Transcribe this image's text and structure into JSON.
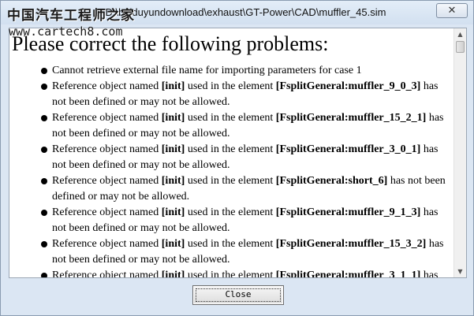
{
  "window": {
    "title_path": "e: D:\\baiduyundownload\\exhaust\\GT-Power\\CAD\\muffler_45.sim",
    "close_glyph": "✕"
  },
  "watermark": {
    "title": "中国汽车工程师之家",
    "url": "www.cartech8.com"
  },
  "content": {
    "heading": "Please correct the following problems:",
    "problems": [
      {
        "plain": "Cannot retrieve external file name for importing parameters for case 1"
      },
      {
        "pre": "Reference object named ",
        "obj": "[init]",
        "mid": " used in the element ",
        "elem": "[FsplitGeneral:muffler_9_0_3]",
        "post": " has not been defined or may not be allowed."
      },
      {
        "pre": "Reference object named ",
        "obj": "[init]",
        "mid": " used in the element ",
        "elem": "[FsplitGeneral:muffler_15_2_1]",
        "post": " has not been defined or may not be allowed."
      },
      {
        "pre": "Reference object named ",
        "obj": "[init]",
        "mid": " used in the element ",
        "elem": "[FsplitGeneral:muffler_3_0_1]",
        "post": " has not been defined or may not be allowed."
      },
      {
        "pre": "Reference object named ",
        "obj": "[init]",
        "mid": " used in the element ",
        "elem": "[FsplitGeneral:short_6]",
        "post": " has not been defined or may not be allowed."
      },
      {
        "pre": "Reference object named ",
        "obj": "[init]",
        "mid": " used in the element ",
        "elem": "[FsplitGeneral:muffler_9_1_3]",
        "post": " has not been defined or may not be allowed."
      },
      {
        "pre": "Reference object named ",
        "obj": "[init]",
        "mid": " used in the element ",
        "elem": "[FsplitGeneral:muffler_15_3_2]",
        "post": " has not been defined or may not be allowed."
      },
      {
        "pre": "Reference object named ",
        "obj": "[init]",
        "mid": " used in the element ",
        "elem": "[FsplitGeneral:muffler_3_1_1]",
        "post": " has"
      }
    ]
  },
  "scrollbar": {
    "up_glyph": "▲",
    "down_glyph": "▼"
  },
  "footer": {
    "close_label": "Close"
  }
}
